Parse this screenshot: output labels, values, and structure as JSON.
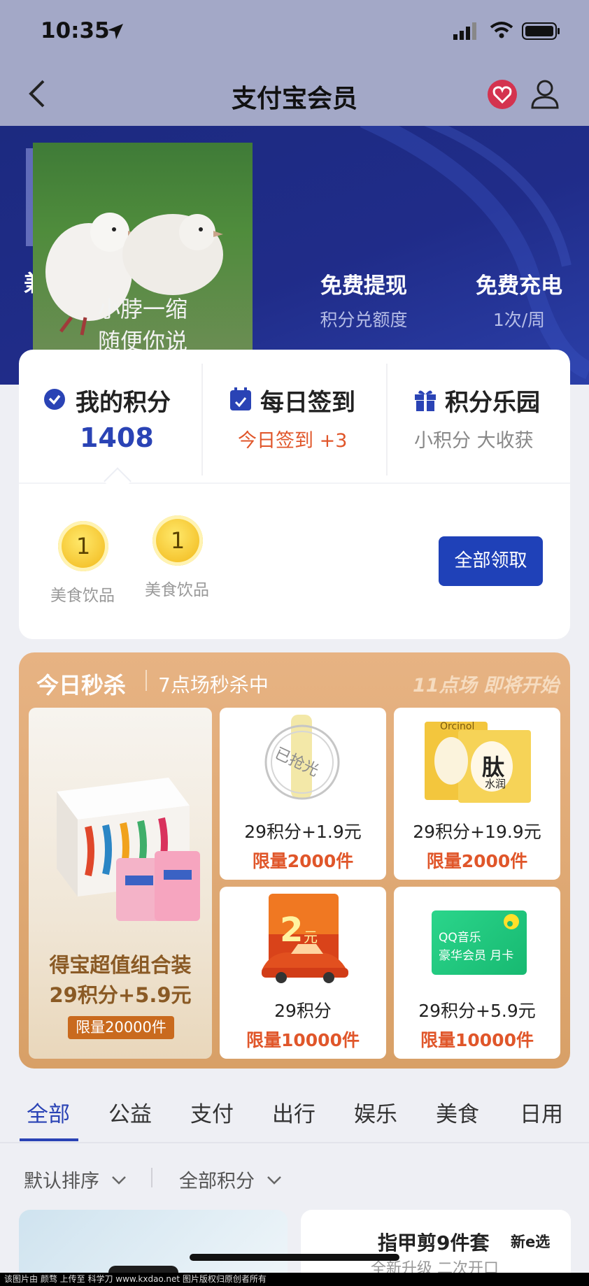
{
  "status": {
    "time": "10:35"
  },
  "nav": {
    "title": "支付宝会员"
  },
  "benefits": [
    {
      "title": "免费提现",
      "sub": "积分兑额度"
    },
    {
      "title": "免费充电",
      "sub": "1次/周"
    }
  ],
  "meme": {
    "line1": "小脖一缩",
    "line2": "随便你说"
  },
  "points": {
    "label": "我的积分",
    "value": "1408"
  },
  "checkin": {
    "label": "每日签到",
    "sub": "今日签到 +3"
  },
  "park": {
    "label": "积分乐园",
    "sub": "小积分 大收获"
  },
  "coins": [
    {
      "value": "1",
      "caption": "美食饮品"
    },
    {
      "value": "1",
      "caption": "美食饮品"
    }
  ],
  "claim_all": "全部领取",
  "seckill": {
    "title": "今日秒杀",
    "session": "7点场秒杀中",
    "next": "11点场 即将开始",
    "main": {
      "name": "得宝超值组合装",
      "price": "29积分+5.9元",
      "limit": "限量20000件"
    },
    "items": [
      {
        "price": "29积分+1.9元",
        "limit": "限量2000件",
        "stamp": "已抢光"
      },
      {
        "price": "29积分+19.9元",
        "limit": "限量2000件",
        "brand": "Orcinol",
        "art": "肽",
        "art2": "水润"
      },
      {
        "price": "29积分",
        "limit": "限量10000件",
        "badge": "2",
        "unit": "元"
      },
      {
        "price": "29积分+5.9元",
        "limit": "限量10000件",
        "card1": "QQ音乐",
        "card2": "豪华会员 月卡"
      }
    ]
  },
  "tabs": [
    "全部",
    "公益",
    "支付",
    "出行",
    "娱乐",
    "美食",
    "日用"
  ],
  "sort": {
    "order": "默认排序",
    "range": "全部积分"
  },
  "product": {
    "title": "指甲剪9件套",
    "sub": "全新升级 二次开口",
    "brand": "新e选"
  },
  "footer": "该图片由 颜骛 上传至 科学刀 www.kxdao.net 图片版权归原创者所有",
  "colors": {
    "accent": "#1f41b8",
    "limit": "#e0562a",
    "banner": "#202c89"
  }
}
